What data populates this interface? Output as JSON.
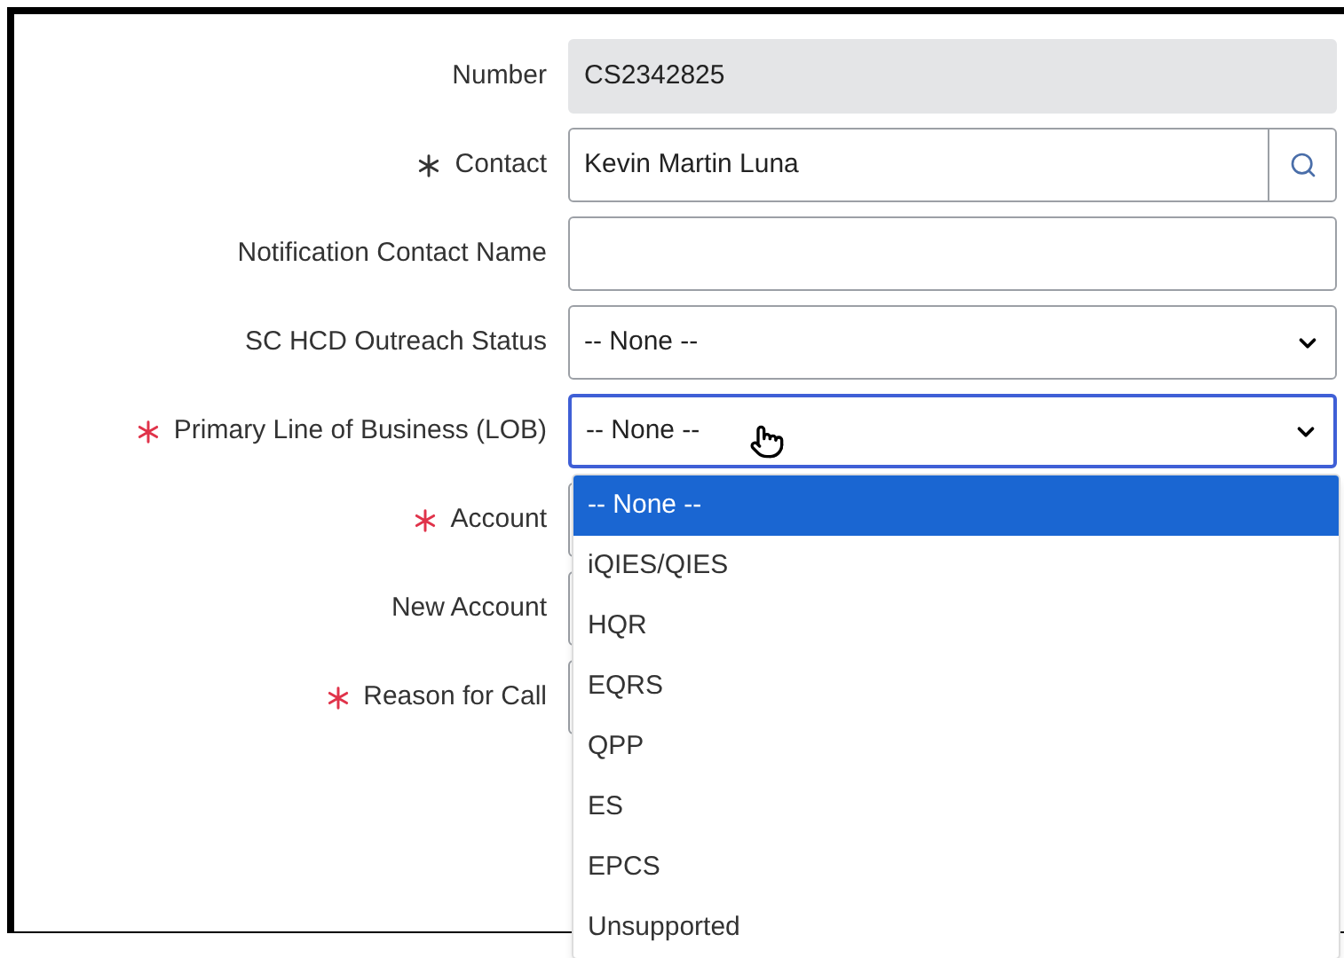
{
  "fields": [
    {
      "label": "Number",
      "required": false,
      "kind": "readonly",
      "value": "CS2342825"
    },
    {
      "label": "Contact",
      "required": true,
      "requirement_met": true,
      "kind": "lookup",
      "value": "Kevin Martin Luna"
    },
    {
      "label": "Notification Contact Name",
      "required": false,
      "kind": "text"
    },
    {
      "label": "SC HCD Outreach Status",
      "required": false,
      "kind": "select",
      "value": "-- None --",
      "focused": false
    },
    {
      "label": "Primary Line of Business (LOB)",
      "required": true,
      "requirement_met": false,
      "kind": "select",
      "value": "-- None --",
      "focused": true
    },
    {
      "label": "Account",
      "required": true,
      "requirement_met": false,
      "kind": "text"
    },
    {
      "label": "New Account",
      "required": false,
      "kind": "text"
    },
    {
      "label": "Reason for Call",
      "required": true,
      "requirement_met": false,
      "kind": "text"
    }
  ],
  "dropdown": {
    "open": true,
    "options": [
      {
        "label": "-- None --",
        "selected": true
      },
      {
        "label": "iQIES/QIES",
        "selected": false
      },
      {
        "label": "HQR",
        "selected": false
      },
      {
        "label": "EQRS",
        "selected": false
      },
      {
        "label": "QPP",
        "selected": false
      },
      {
        "label": "ES",
        "selected": false
      },
      {
        "label": "EPCS",
        "selected": false
      },
      {
        "label": "Unsupported",
        "selected": false
      }
    ]
  }
}
